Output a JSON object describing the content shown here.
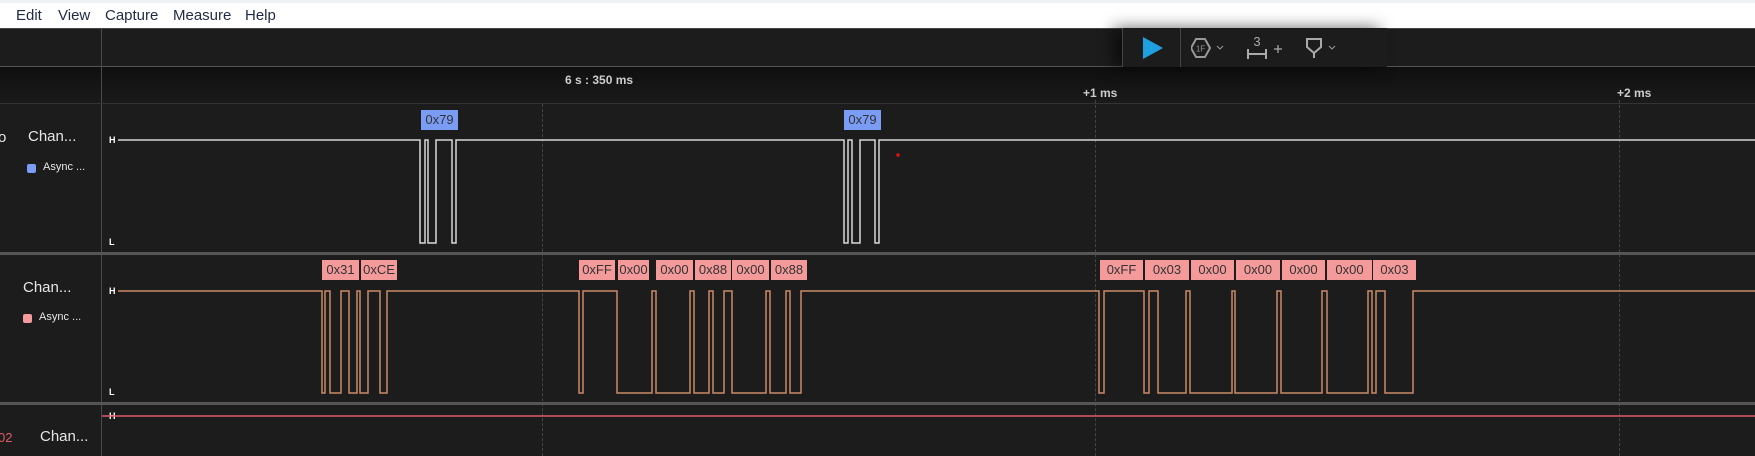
{
  "menu": {
    "items": [
      "Edit",
      "View",
      "Capture",
      "Measure",
      "Help"
    ]
  },
  "toolbar": {
    "play_icon": "play-icon",
    "trigger_icon": "hex-1f-icon",
    "measure_count": "3",
    "measure_add": "+",
    "marker_icon": "marker-icon",
    "chevron": "⌄"
  },
  "timeline": {
    "origin": "6 s : 350 ms",
    "tick1": "+1 ms",
    "tick2": "+2 ms"
  },
  "channels": [
    {
      "index_fragment": "o",
      "name": "Chan...",
      "analyzer": "Async ...",
      "color": "#7a9cf5",
      "high": "H",
      "low": "L",
      "frames": [
        "0x79",
        "0x79"
      ]
    },
    {
      "index_fragment": "",
      "name": "Chan...",
      "analyzer": "Async ...",
      "color": "#f59a9a",
      "high": "H",
      "low": "L",
      "frames": [
        "0x31",
        "0xCE",
        "0xFF",
        "0x00",
        "0x00",
        "0x88",
        "0x00",
        "0x88",
        "0xFF",
        "0x03",
        "0x00",
        "0x00",
        "0x00",
        "0x00",
        "0x03"
      ]
    },
    {
      "index_fragment": "02",
      "name": "Chan...",
      "high": "H"
    }
  ],
  "colors": {
    "ch0_wave": "#d8d8d8",
    "ch1_wave": "#c98a68",
    "ch2_wave": "#e05a6a",
    "play": "#1e9fe0"
  }
}
